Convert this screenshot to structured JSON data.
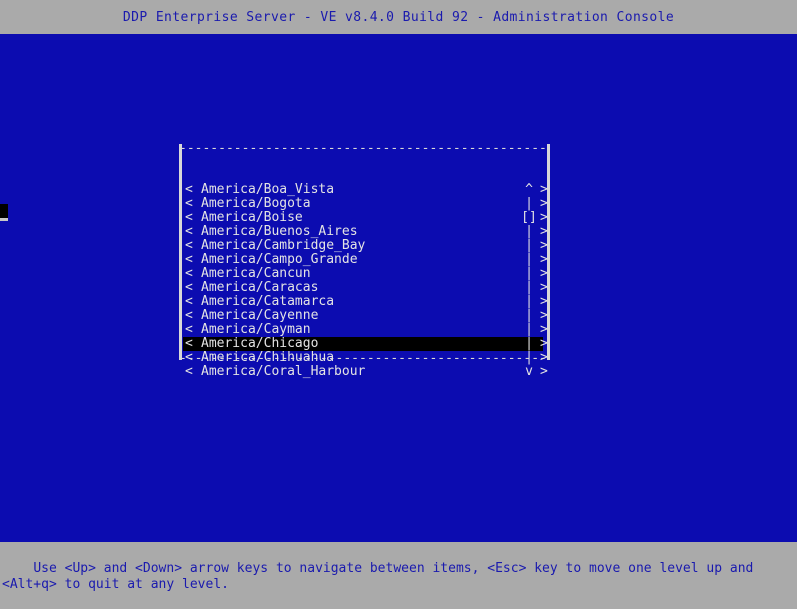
{
  "titlebar": {
    "title": "DDP Enterprise Server - VE v8.4.0 Build 92 - Administration Console"
  },
  "colors": {
    "background_blue": "#0c0cb0",
    "chrome_gray": "#aaaaaa",
    "chrome_text_blue": "#1a1aae",
    "list_text": "#e4e4e4",
    "selected_background": "#000000",
    "border": "#d8d8d8"
  },
  "listbox": {
    "border_top": "----------------------------------------------------------",
    "border_bottom": "----------------------------------------------------------",
    "left_marker": "<",
    "right_marker": ">",
    "scroll_up_marker": "^",
    "scroll_down_marker": "v",
    "scroll_track_marker": "|",
    "scroll_thumb_marker": "[]",
    "selected_index": 11,
    "items": [
      {
        "label": "America/Boa_Vista",
        "scroll": "^"
      },
      {
        "label": "America/Bogota",
        "scroll": "|"
      },
      {
        "label": "America/Boise",
        "scroll": "[]"
      },
      {
        "label": "America/Buenos_Aires",
        "scroll": "|"
      },
      {
        "label": "America/Cambridge_Bay",
        "scroll": "|"
      },
      {
        "label": "America/Campo_Grande",
        "scroll": "|"
      },
      {
        "label": "America/Cancun",
        "scroll": "|"
      },
      {
        "label": "America/Caracas",
        "scroll": "|"
      },
      {
        "label": "America/Catamarca",
        "scroll": "|"
      },
      {
        "label": "America/Cayenne",
        "scroll": "|"
      },
      {
        "label": "America/Cayman",
        "scroll": "|"
      },
      {
        "label": "America/Chicago",
        "scroll": "|"
      },
      {
        "label": "America/Chihuahua",
        "scroll": "|"
      },
      {
        "label": "America/Coral_Harbour",
        "scroll": "v"
      }
    ]
  },
  "statusbar": {
    "help_text": "Use <Up> and <Down> arrow keys to navigate between items, <Esc> key to move one level up and <Alt+q> to quit at any level."
  }
}
